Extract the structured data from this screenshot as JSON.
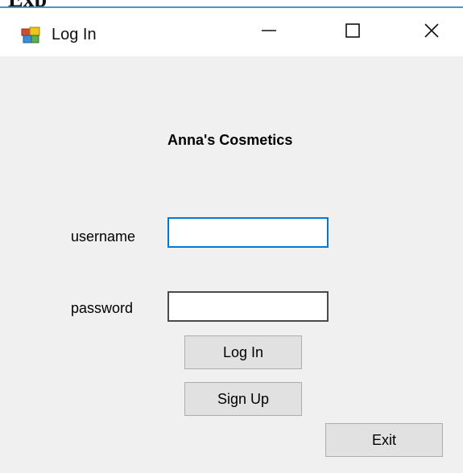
{
  "page_heading_fragment": "Exp",
  "window": {
    "title": "Log In",
    "controls": {
      "minimize_icon": "minimize-icon",
      "maximize_icon": "maximize-icon",
      "close_icon": "close-icon"
    },
    "app_icon": "windows-form-icon"
  },
  "form": {
    "brand_title": "Anna's Cosmetics",
    "username": {
      "label": "username",
      "value": "",
      "placeholder": ""
    },
    "password": {
      "label": "password",
      "value": "",
      "placeholder": ""
    },
    "buttons": {
      "login_label": "Log In",
      "signup_label": "Sign Up",
      "exit_label": "Exit"
    }
  },
  "colors": {
    "window_background": "#f0f0f0",
    "titlebar_background": "#ffffff",
    "focus_border": "#0078d7",
    "button_face": "#e1e1e1",
    "accent_line": "#5b8fc4"
  }
}
